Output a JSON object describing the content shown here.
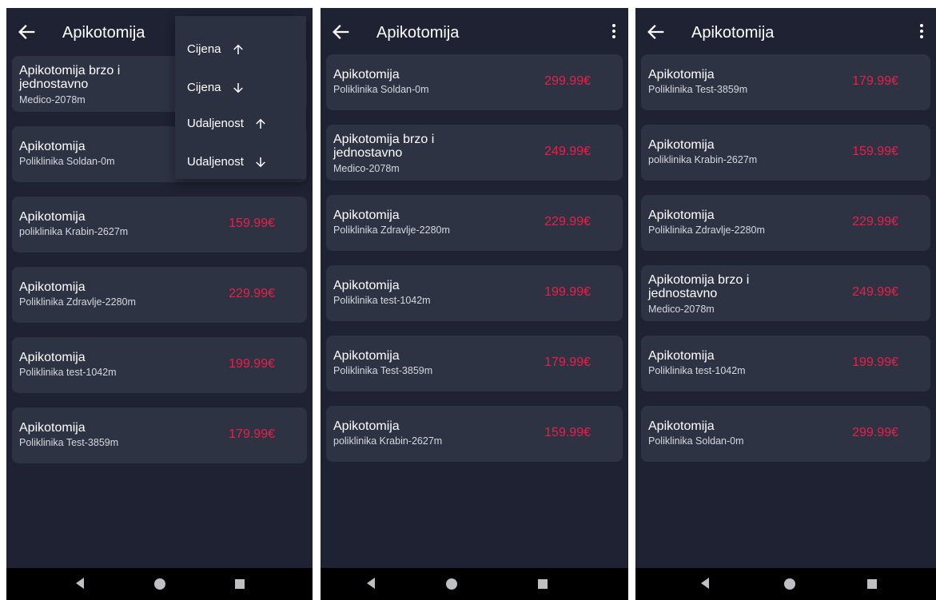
{
  "icons": {
    "back": "arrow-left-icon",
    "more": "more-vertical-icon",
    "arrow_up": "arrow-up-icon",
    "arrow_down": "arrow-down-icon",
    "nav_back": "triangle-back-icon",
    "nav_home": "circle-home-icon",
    "nav_recent": "square-recents-icon"
  },
  "colors": {
    "background": "#1e2233",
    "card": "#2e3344",
    "price": "#ec1e47",
    "text": "#ffffff"
  },
  "screens": [
    {
      "title": "Apikotomija",
      "menu": {
        "open": true,
        "items": [
          {
            "label": "Cijena",
            "direction": "up"
          },
          {
            "label": "Cijena",
            "direction": "down"
          },
          {
            "label": "Udaljenost",
            "direction": "up"
          },
          {
            "label": "Udaljenost",
            "direction": "down"
          }
        ]
      },
      "items": [
        {
          "name": "Apikotomija brzo i jednostavno",
          "location": "Medico-2078m",
          "price": ""
        },
        {
          "name": "Apikotomija",
          "location": "Poliklinika Soldan-0m",
          "price": ""
        },
        {
          "name": "Apikotomija",
          "location": "poliklinika Krabin-2627m",
          "price": "159.99€"
        },
        {
          "name": "Apikotomija",
          "location": "Poliklinika Zdravlje-2280m",
          "price": "229.99€"
        },
        {
          "name": "Apikotomija",
          "location": "Poliklinika test-1042m",
          "price": "199.99€"
        },
        {
          "name": "Apikotomija",
          "location": "Poliklinika Test-3859m",
          "price": "179.99€"
        }
      ]
    },
    {
      "title": "Apikotomija",
      "items": [
        {
          "name": "Apikotomija",
          "location": "Poliklinika Soldan-0m",
          "price": "299.99€"
        },
        {
          "name": "Apikotomija brzo i jednostavno",
          "location": "Medico-2078m",
          "price": "249.99€"
        },
        {
          "name": "Apikotomija",
          "location": "Poliklinika Zdravlje-2280m",
          "price": "229.99€"
        },
        {
          "name": "Apikotomija",
          "location": "Poliklinika test-1042m",
          "price": "199.99€"
        },
        {
          "name": "Apikotomija",
          "location": "Poliklinika Test-3859m",
          "price": "179.99€"
        },
        {
          "name": "Apikotomija",
          "location": "poliklinika Krabin-2627m",
          "price": "159.99€"
        }
      ]
    },
    {
      "title": "Apikotomija",
      "items": [
        {
          "name": "Apikotomija",
          "location": "Poliklinika Test-3859m",
          "price": "179.99€"
        },
        {
          "name": "Apikotomija",
          "location": "poliklinika Krabin-2627m",
          "price": "159.99€"
        },
        {
          "name": "Apikotomija",
          "location": "Poliklinika Zdravlje-2280m",
          "price": "229.99€"
        },
        {
          "name": "Apikotomija brzo i jednostavno",
          "location": "Medico-2078m",
          "price": "249.99€"
        },
        {
          "name": "Apikotomija",
          "location": "Poliklinika test-1042m",
          "price": "199.99€"
        },
        {
          "name": "Apikotomija",
          "location": "Poliklinika Soldan-0m",
          "price": "299.99€"
        }
      ]
    }
  ]
}
